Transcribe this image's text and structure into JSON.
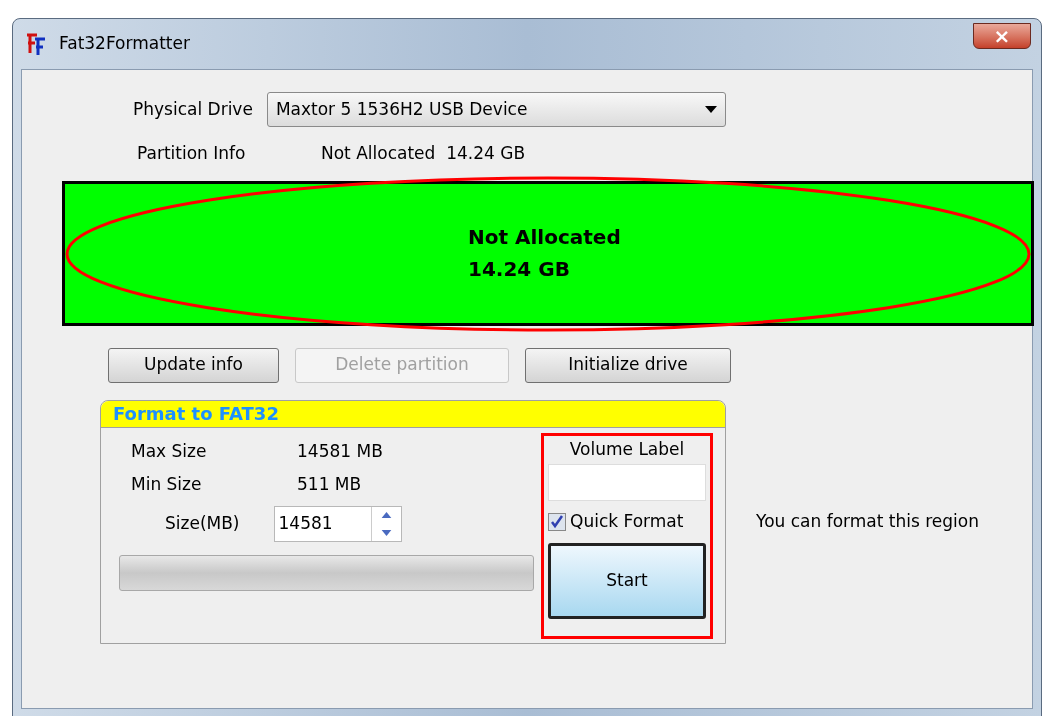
{
  "window": {
    "title": "Fat32Formatter",
    "close": "×"
  },
  "physical_drive": {
    "label": "Physical Drive",
    "value": "Maxtor 5 1536H2 USB Device"
  },
  "partition_info": {
    "label": "Partition Info",
    "value": "Not Allocated  14.24 GB"
  },
  "partition_map": {
    "lines": [
      "Not Allocated",
      "14.24 GB"
    ],
    "color": "#00ff00",
    "highlighted": true
  },
  "buttons": [
    {
      "label": "Update info",
      "disabled": false
    },
    {
      "label": "Delete partition",
      "disabled": true
    },
    {
      "label": "Initialize drive",
      "disabled": false
    }
  ],
  "format_group": {
    "title": "Format to FAT32",
    "rows": [
      {
        "label": "Max Size",
        "value": "14581 MB"
      },
      {
        "label": "Min Size",
        "value": "511 MB"
      }
    ],
    "size": {
      "label": "Size(MB)",
      "value": "14581"
    },
    "progress": {
      "level": 0
    },
    "volume_label": {
      "label": "Volume Label"
    },
    "quick_format": {
      "label": "Quick Format",
      "checked": true
    },
    "start": "Start",
    "highlighted": true
  },
  "hint": "You can format this region"
}
